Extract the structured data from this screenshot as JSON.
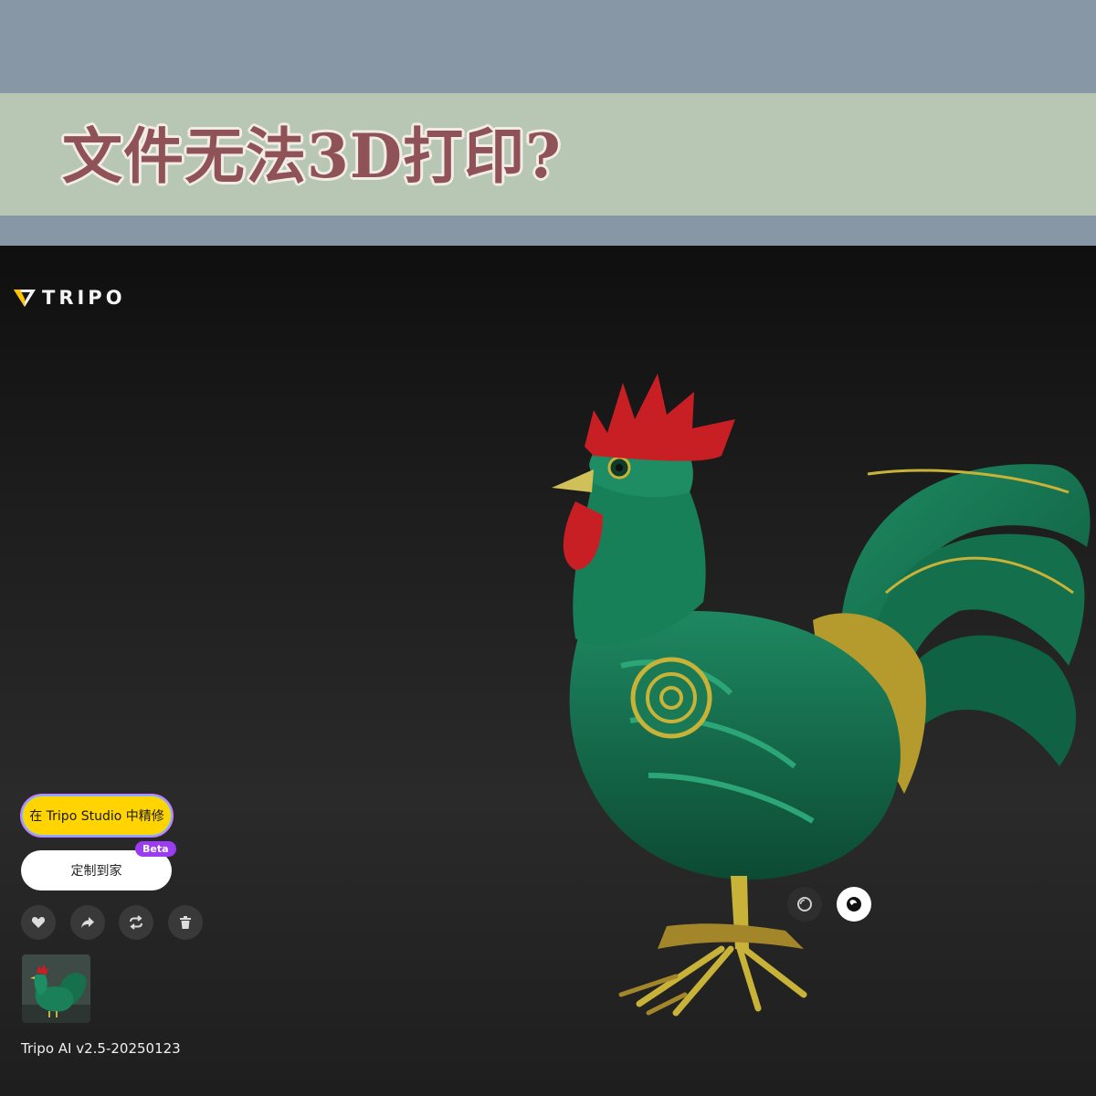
{
  "banner": {
    "title": "文件无法3D打印?"
  },
  "app": {
    "logo_text": "TRIPO"
  },
  "actions": {
    "refine_label": "在 Tripo Studio 中精修",
    "customize_label": "定制到家",
    "beta_badge": "Beta",
    "icon_buttons": [
      {
        "name": "heart-icon"
      },
      {
        "name": "share-icon"
      },
      {
        "name": "repeat-icon"
      },
      {
        "name": "trash-icon"
      }
    ]
  },
  "model": {
    "subject": "rooster",
    "version": "Tripo AI v2.5-20250123"
  },
  "view_modes": [
    "circle-outline-icon",
    "sphere-shaded-icon"
  ],
  "colors": {
    "band": "#8797a5",
    "strip": "#b7c7b4",
    "title": "#8f5357",
    "studio_button": "#ffd400",
    "beta": "#9b3cf3"
  }
}
